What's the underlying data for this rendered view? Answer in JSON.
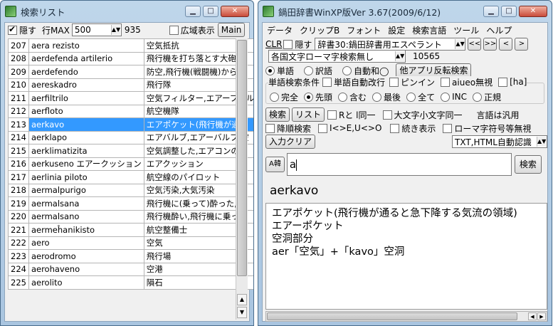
{
  "left_window": {
    "title": "検索リスト",
    "hide_label": "隠す",
    "hide_checked": true,
    "rowmax_label": "行MAX",
    "rowmax_value": "500",
    "count": "935",
    "wide_label": "広域表示",
    "main_label": "Main",
    "rows": [
      {
        "num": "207",
        "word": "aera rezisto",
        "meaning": "空気抵抗"
      },
      {
        "num": "208",
        "word": "aerdefenda artilerio",
        "meaning": "飛行機を打ち落とす大砲"
      },
      {
        "num": "209",
        "word": "aerdefendo",
        "meaning": "防空,飛行機(戦闘機)から"
      },
      {
        "num": "210",
        "word": "aereskadro",
        "meaning": "飛行隊"
      },
      {
        "num": "211",
        "word": "aerfiltrilo",
        "meaning": "空気フィルター,エアーフィル"
      },
      {
        "num": "212",
        "word": "aerfloto",
        "meaning": "航空機隊"
      },
      {
        "num": "213",
        "word": "aerkavo",
        "meaning": "エアポケット(飛行機が通る"
      },
      {
        "num": "214",
        "word": "aerklapo",
        "meaning": "エアバルブ,エアーバルブ,空"
      },
      {
        "num": "215",
        "word": "aerklimatizita",
        "meaning": "空気調整した,エアコンの効"
      },
      {
        "num": "216",
        "word": "aerkuseno エアークッション",
        "meaning": "エアクッション"
      },
      {
        "num": "217",
        "word": "aerlinia piloto",
        "meaning": "航空線のパイロット"
      },
      {
        "num": "218",
        "word": "aermalpurigo",
        "meaning": "空気汚染,大気汚染"
      },
      {
        "num": "219",
        "word": "aermalsana",
        "meaning": "飛行機に(乗って)酔った,飛"
      },
      {
        "num": "220",
        "word": "aermalsano",
        "meaning": "飛行機酔い,飛行機に乗っ"
      },
      {
        "num": "221",
        "word": "aermeĥanikisto",
        "meaning": "航空整備士"
      },
      {
        "num": "222",
        "word": "aero",
        "meaning": "空気"
      },
      {
        "num": "223",
        "word": "aerodromo",
        "meaning": "飛行場"
      },
      {
        "num": "224",
        "word": "aerohaveno",
        "meaning": "空港"
      },
      {
        "num": "225",
        "word": "aerolito",
        "meaning": "隕石"
      }
    ],
    "selected_index": 6
  },
  "right_window": {
    "title": "鍋田辞書WinXP版Ver 3.67(2009/6/12)",
    "menu": [
      "データ",
      "クリップB",
      "フォント",
      "設定",
      "検索言語",
      "ツール",
      "ヘルプ"
    ],
    "clr_label": "CLR",
    "hide_label": "隠す",
    "dict_select": "辞書30:鍋田辞書用エスペラント",
    "nav": [
      "<<",
      ">>",
      "<",
      ">"
    ],
    "mode_select": "各国文字ローマ字検索無し",
    "entry_count": "10565",
    "radio_word": "単語",
    "radio_translation": "訳語",
    "radio_auto": "自動和◯",
    "other_app_button": "他アプリ反転検索",
    "cond_label": "単語検索条件",
    "auto_newline": "単語自動改行",
    "pinpoint": "ピンイン",
    "aiueo_ignore": "aiueo無視",
    "ha": "[ha]",
    "match_options": [
      "完全",
      "先頭",
      "含む",
      "最後",
      "全て",
      "INC",
      "正規"
    ],
    "match_selected": 1,
    "search_button": "検索",
    "list_button": "リスト",
    "rl_same": "Rと l同一",
    "case_same": "大文字小文字同一",
    "lang_note": "言語は汎用",
    "desc_order": "降順検索",
    "ix_eu": "I<>E,U<>O",
    "continuous": "続き表示",
    "roman_ignore": "ローマ字符号等無視",
    "input_clear": "入力クリア",
    "txt_html": "TXT,HTML自動認識",
    "toggle": "A韓",
    "query": "a",
    "search2": "検索",
    "headword": "aerkavo",
    "definition": [
      "エアポケット(飛行機が通ると急下降する気流の領域)",
      "エアーポケット",
      "空洞部分",
      "aer「空気」+「kavo」空洞"
    ]
  }
}
